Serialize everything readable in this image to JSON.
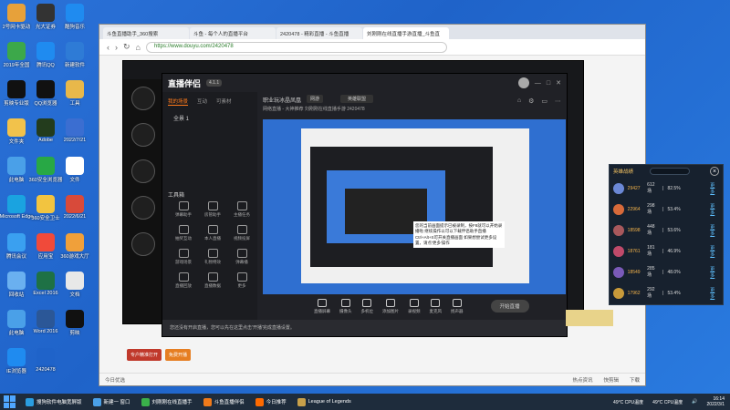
{
  "desktop_icons": [
    {
      "label": "2号网卡驱动",
      "color": "#e7a13a"
    },
    {
      "label": "光大证券",
      "color": "#333"
    },
    {
      "label": "酷狗音乐",
      "color": "#1f8bf0"
    },
    {
      "label": "2019年全国",
      "color": "#3ca84a"
    },
    {
      "label": "腾讯QQ",
      "color": "#1f8bf0"
    },
    {
      "label": "新建软件",
      "color": "#2e7bd6"
    },
    {
      "label": "剪映专业版",
      "color": "#111"
    },
    {
      "label": "QQ浏览器",
      "color": "#111"
    },
    {
      "label": "工具",
      "color": "#e8b84a"
    },
    {
      "label": "文件夹",
      "color": "#f2c24b"
    },
    {
      "label": "Adobe",
      "color": "#233c1d"
    },
    {
      "label": "2022/7/21",
      "color": "#3b6ed1"
    },
    {
      "label": "此电脑",
      "color": "#4aa0e8"
    },
    {
      "label": "360安全浏览器",
      "color": "#28a845"
    },
    {
      "label": "文件",
      "color": "#fff"
    },
    {
      "label": "Microsoft Edge",
      "color": "#1aa3e0"
    },
    {
      "label": "360安全卫士",
      "color": "#f2c440"
    },
    {
      "label": "2022/6/21",
      "color": "#d84a3a"
    },
    {
      "label": "腾讯会议",
      "color": "#3aa0f0"
    },
    {
      "label": "应用宝",
      "color": "#f04a3a"
    },
    {
      "label": "360游戏大厅",
      "color": "#f0a03a"
    },
    {
      "label": "回收站",
      "color": "#6ab0f0"
    },
    {
      "label": "Excel 2016",
      "color": "#1e7145"
    },
    {
      "label": "文档",
      "color": "#e8e8e8"
    },
    {
      "label": "此电脑",
      "color": "#4aa0e8"
    },
    {
      "label": "Word 2016",
      "color": "#2b5797"
    },
    {
      "label": "剪映",
      "color": "#111"
    },
    {
      "label": "IE浏览器",
      "color": "#1f8bf0"
    },
    {
      "label": "2420478",
      "color": "#1f63c9"
    }
  ],
  "browser": {
    "tabs": [
      "斗鱼直播助手_360搜索",
      "斗鱼 - 每个人的直播平台",
      "2420478 - 精彩直播 - 斗鱼直播",
      "刘刚刚在线直播手游直播_斗鱼直"
    ],
    "url": "https://www.douyu.com/2420478",
    "status_left": "今日优选",
    "status_right": [
      "热点资讯",
      "快剪辑",
      "下载"
    ]
  },
  "companion": {
    "logo": "直播伴侣",
    "badge": "4.1.1",
    "scene_tabs": [
      "我的场景",
      "互动",
      "可素材"
    ],
    "scene_name": "全景 1",
    "tools_label": "工具箱",
    "tools": [
      "弹幕助手",
      "房管助手",
      "主播任务",
      "抽奖互动",
      "本人直播",
      "视频投屏",
      "游戏场景",
      "礼物特效",
      "弹幕播",
      "直播回放",
      "直播数据",
      "更多"
    ],
    "title": "职业玩冰晶凤凰",
    "category": "网游",
    "category2": "英雄联盟",
    "subline": "网络直播 - 大神推荐    刘刚刚在线直播手游    2420478",
    "bottom_buttons": [
      "直播屏幕",
      "摄像头",
      "多机位",
      "添加图片",
      "录视频",
      "麦克风",
      "扬声器"
    ],
    "start_live": "开始直播",
    "notice": "您还没有开启直播，您可以先在这里点击'开播'完成直播设置。",
    "tooltip": "您的当前画面提示已被录制，按F8就可以开始录播啦\n继续操作以可以下载伴侣助手直播\nCtrl+Alt+S可开关直播画面\n如果想尝试更多设置，请点'更多'操作"
  },
  "dark_window": {
    "bottom_left": "专户精准打开",
    "bottom_right": "免费开播"
  },
  "ranking": {
    "title": "英雄战绩",
    "rows": [
      {
        "score": "29427",
        "games": "612场",
        "rate": "82.5%",
        "action": "更多",
        "color": "#6b88d6"
      },
      {
        "score": "22964",
        "games": "298场",
        "rate": "53.4%",
        "action": "更多",
        "color": "#d86a3a"
      },
      {
        "score": "18598",
        "games": "448场",
        "rate": "53.6%",
        "action": "更多",
        "color": "#a8585c"
      },
      {
        "score": "18761",
        "games": "181场",
        "rate": "46.9%",
        "action": "更多",
        "color": "#c04a6a"
      },
      {
        "score": "18549",
        "games": "285场",
        "rate": "48.0%",
        "action": "更多",
        "color": "#7a5ab8"
      },
      {
        "score": "17962",
        "games": "292场",
        "rate": "53.4%",
        "action": "更多",
        "color": "#c89a3a"
      }
    ]
  },
  "taskbar": {
    "items": [
      {
        "label": "搜狗软件电脑宽屏版",
        "color": "#2a9de0"
      },
      {
        "label": "新建一 窗口",
        "color": "#4aa0e8"
      },
      {
        "label": "刘刚刚在线直播手",
        "color": "#3ab04a"
      },
      {
        "label": "斗鱼直播伴侣",
        "color": "#f07a1a"
      },
      {
        "label": "今日推荐",
        "color": "#ff6a00"
      },
      {
        "label": "League of Legends",
        "color": "#c8a04a"
      }
    ],
    "cpu1": "49°C CPU温度",
    "cpu2": "49°C CPU温度",
    "time": "16:14",
    "date": "2022/3/1"
  }
}
